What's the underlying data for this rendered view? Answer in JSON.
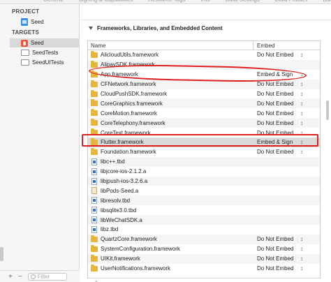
{
  "topbar": {
    "tabs": [
      "General",
      "Signing & Capabilities",
      "Resource Tags",
      "Info",
      "Build Settings",
      "Build Phases",
      "Build Rules"
    ]
  },
  "sidebar": {
    "project_heading": "PROJECT",
    "project_item": "Seed",
    "targets_heading": "TARGETS",
    "targets": [
      {
        "label": "Seed",
        "icon": "app-target-icon",
        "selected": true
      },
      {
        "label": "SeedTests",
        "icon": "test-target-icon",
        "selected": false
      },
      {
        "label": "SeedUITests",
        "icon": "test-target-icon",
        "selected": false
      }
    ],
    "footer": {
      "add": "+",
      "remove": "−",
      "filter_placeholder": "Filter"
    }
  },
  "section": {
    "title": "Frameworks, Libraries, and Embedded Content"
  },
  "table": {
    "col_name": "Name",
    "col_embed": "Embed",
    "rows": [
      {
        "name": "AlicloudUtils.framework",
        "embed": "Do Not Embed",
        "icon": "framework"
      },
      {
        "name": "AlipaySDK.framework",
        "embed": "",
        "icon": "framework"
      },
      {
        "name": "App.framework",
        "embed": "Embed & Sign",
        "icon": "framework"
      },
      {
        "name": "CFNetwork.framework",
        "embed": "Do Not Embed",
        "icon": "framework"
      },
      {
        "name": "CloudPushSDK.framework",
        "embed": "Do Not Embed",
        "icon": "framework"
      },
      {
        "name": "CoreGraphics.framework",
        "embed": "Do Not Embed",
        "icon": "framework"
      },
      {
        "name": "CoreMotion.framework",
        "embed": "Do Not Embed",
        "icon": "framework"
      },
      {
        "name": "CoreTelephony.framework",
        "embed": "Do Not Embed",
        "icon": "framework"
      },
      {
        "name": "CoreText.framework",
        "embed": "Do Not Embed",
        "icon": "framework"
      },
      {
        "name": "Flutter.framework",
        "embed": "Embed & Sign",
        "icon": "framework"
      },
      {
        "name": "Foundation.framework",
        "embed": "Do Not Embed",
        "icon": "framework"
      },
      {
        "name": "libc++.tbd",
        "embed": "",
        "icon": "tbd"
      },
      {
        "name": "libjcore-ios-2.1.2.a",
        "embed": "",
        "icon": "tbd"
      },
      {
        "name": "libjpush-ios-3.2.6.a",
        "embed": "",
        "icon": "tbd"
      },
      {
        "name": "libPods-Seed.a",
        "embed": "",
        "icon": "archive"
      },
      {
        "name": "libresolv.tbd",
        "embed": "",
        "icon": "tbd"
      },
      {
        "name": "libsqlite3.0.tbd",
        "embed": "",
        "icon": "tbd"
      },
      {
        "name": "libWeChatSDK.a",
        "embed": "",
        "icon": "tbd"
      },
      {
        "name": "libz.tbd",
        "embed": "",
        "icon": "tbd"
      },
      {
        "name": "QuartzCore.framework",
        "embed": "Do Not Embed",
        "icon": "framework"
      },
      {
        "name": "SystemConfiguration.framework",
        "embed": "Do Not Embed",
        "icon": "framework"
      },
      {
        "name": "UIKit.framework",
        "embed": "Do Not Embed",
        "icon": "framework"
      },
      {
        "name": "UserNotifications.framework",
        "embed": "Do Not Embed",
        "icon": "framework"
      }
    ],
    "footer": {
      "add": "+",
      "remove": "−"
    }
  },
  "annotation_color": "#e02020"
}
